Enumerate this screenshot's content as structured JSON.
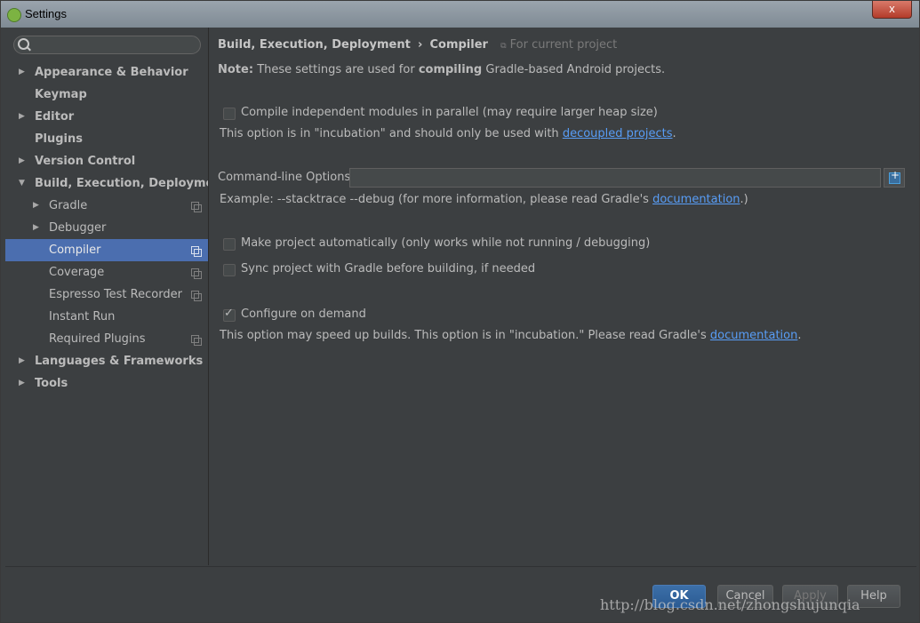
{
  "window": {
    "title": "Settings",
    "close_glyph": "x"
  },
  "sidebar": {
    "search_placeholder": "",
    "items": [
      {
        "label": "Appearance & Behavior",
        "bold": true,
        "arrow": "▶",
        "level": 0
      },
      {
        "label": "Keymap",
        "bold": true,
        "arrow": "",
        "level": 0
      },
      {
        "label": "Editor",
        "bold": true,
        "arrow": "▶",
        "level": 0
      },
      {
        "label": "Plugins",
        "bold": true,
        "arrow": "",
        "level": 0
      },
      {
        "label": "Version Control",
        "bold": true,
        "arrow": "▶",
        "level": 0
      },
      {
        "label": "Build, Execution, Deployment",
        "bold": true,
        "arrow": "▼",
        "level": 0
      },
      {
        "label": "Gradle",
        "arrow": "▶",
        "level": 1,
        "project_icon": true
      },
      {
        "label": "Debugger",
        "arrow": "▶",
        "level": 1
      },
      {
        "label": "Compiler",
        "arrow": "",
        "level": 1,
        "project_icon": true,
        "selected": true
      },
      {
        "label": "Coverage",
        "arrow": "",
        "level": 1,
        "project_icon": true
      },
      {
        "label": "Espresso Test Recorder",
        "arrow": "",
        "level": 1,
        "project_icon": true
      },
      {
        "label": "Instant Run",
        "arrow": "",
        "level": 1
      },
      {
        "label": "Required Plugins",
        "arrow": "",
        "level": 1,
        "project_icon": true
      },
      {
        "label": "Languages & Frameworks",
        "bold": true,
        "arrow": "▶",
        "level": 0
      },
      {
        "label": "Tools",
        "bold": true,
        "arrow": "▶",
        "level": 0
      }
    ]
  },
  "breadcrumb": {
    "parent": "Build, Execution, Deployment",
    "separator": "›",
    "current": "Compiler",
    "scope": "For current project"
  },
  "note": {
    "prefix": "Note:",
    "text_a": "These settings are used for",
    "emphasis": "compiling",
    "text_b": "Gradle-based Android projects."
  },
  "options": {
    "parallel": {
      "label": "Compile independent modules in parallel (may require larger heap size)",
      "checked": false,
      "hint": "This option is in \"incubation\" and should only be used with",
      "hint_link": "decoupled projects",
      "hint_end": "."
    },
    "cmdline": {
      "label": "Command-line Options:",
      "value": "",
      "example": "Example: --stacktrace --debug (for more information, please read Gradle's",
      "example_link": "documentation",
      "example_end": ".)"
    },
    "make_auto": {
      "label": "Make project automatically (only works while not running / debugging)",
      "checked": false
    },
    "sync": {
      "label": "Sync project with Gradle before building, if needed",
      "checked": false
    },
    "configure": {
      "label": "Configure on demand",
      "checked": true,
      "hint": "This option may speed up builds. This option is in \"incubation.\" Please read Gradle's",
      "hint_link": "documentation",
      "hint_end": "."
    }
  },
  "buttons": {
    "ok": "OK",
    "cancel": "Cancel",
    "apply": "Apply",
    "help": "Help"
  },
  "watermark": "http://blog.csdn.net/zhongshujunqia",
  "colors": {
    "background": "#3c3f41",
    "selection": "#4b6eaf",
    "link": "#589df6",
    "text": "#bbbbbb"
  }
}
